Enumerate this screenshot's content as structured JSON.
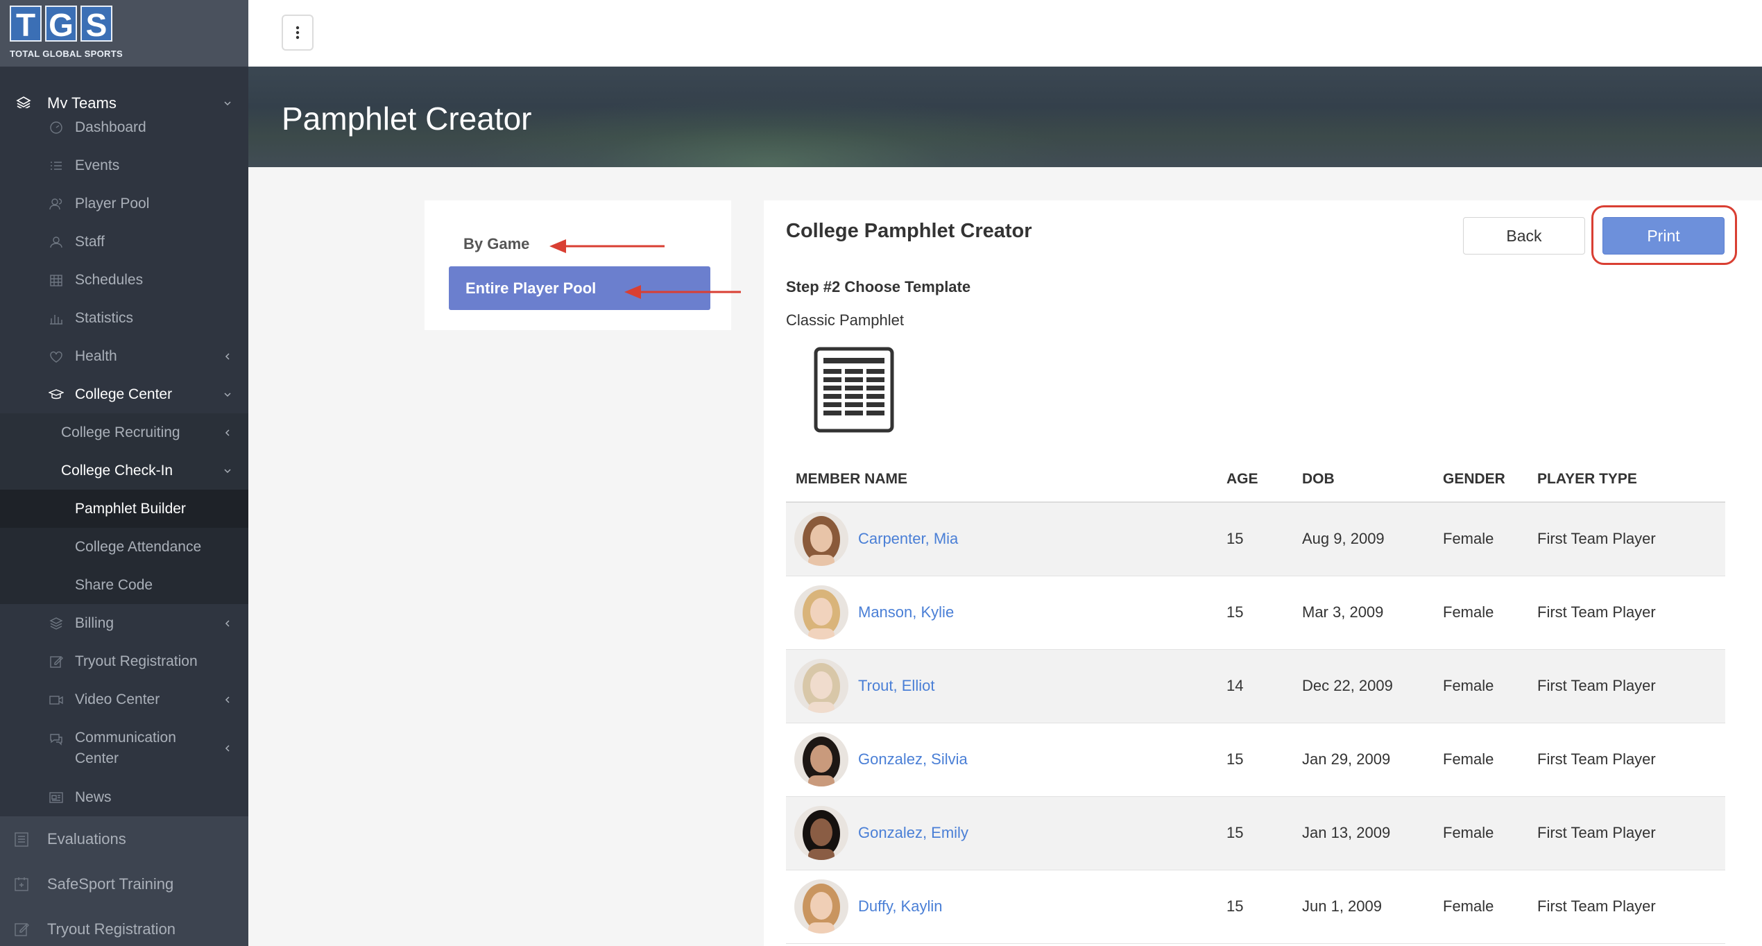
{
  "logo": {
    "letters": [
      "T",
      "G",
      "S"
    ],
    "subtitle": "TOTAL GLOBAL SPORTS"
  },
  "sidebar": {
    "my_teams": "My Teams",
    "items": [
      {
        "label": "Dashboard",
        "icon": "dashboard-icon"
      },
      {
        "label": "Events",
        "icon": "list-icon"
      },
      {
        "label": "Player Pool",
        "icon": "users-icon"
      },
      {
        "label": "Staff",
        "icon": "user-icon"
      },
      {
        "label": "Schedules",
        "icon": "calendar-icon"
      },
      {
        "label": "Statistics",
        "icon": "bar-chart-icon"
      },
      {
        "label": "Health",
        "icon": "heart-icon"
      }
    ],
    "college_center": "College Center",
    "college_recruiting": "College Recruiting",
    "college_checkin": "College Check-In",
    "checkin_items": [
      "Pamphlet Builder",
      "College Attendance",
      "Share Code"
    ],
    "more_items": [
      {
        "label": "Billing",
        "icon": "layers-icon"
      },
      {
        "label": "Tryout Registration",
        "icon": "edit-icon"
      },
      {
        "label": "Video Center",
        "icon": "video-icon"
      },
      {
        "label": "Communication Center",
        "icon": "chat-icon"
      },
      {
        "label": "News",
        "icon": "newspaper-icon"
      }
    ],
    "bottom_items": [
      {
        "label": "Evaluations",
        "icon": "clipboard-icon"
      },
      {
        "label": "SafeSport Training",
        "icon": "certificate-icon"
      },
      {
        "label": "Tryout Registration",
        "icon": "edit-icon"
      }
    ]
  },
  "banner": {
    "title": "Pamphlet Creator"
  },
  "left_card": {
    "by_game": "By Game",
    "entire_pool": "Entire Player Pool"
  },
  "main": {
    "title": "College Pamphlet Creator",
    "back": "Back",
    "print": "Print",
    "step": "Step #2 Choose Template",
    "template_name": "Classic Pamphlet",
    "columns": [
      "MEMBER NAME",
      "AGE",
      "DOB",
      "GENDER",
      "PLAYER TYPE"
    ],
    "rows": [
      {
        "name": "Carpenter, Mia",
        "age": "15",
        "dob": "Aug 9, 2009",
        "gender": "Female",
        "type": "First Team Player",
        "hair": "#8a5a3a",
        "skin": "#e8c4a8"
      },
      {
        "name": "Manson, Kylie",
        "age": "15",
        "dob": "Mar 3, 2009",
        "gender": "Female",
        "type": "First Team Player",
        "hair": "#d9b47a",
        "skin": "#f1d3bd"
      },
      {
        "name": "Trout, Elliot",
        "age": "14",
        "dob": "Dec 22, 2009",
        "gender": "Female",
        "type": "First Team Player",
        "hair": "#d8c7a8",
        "skin": "#f0dccd"
      },
      {
        "name": "Gonzalez, Silvia",
        "age": "15",
        "dob": "Jan 29, 2009",
        "gender": "Female",
        "type": "First Team Player",
        "hair": "#1d1714",
        "skin": "#c99a7c"
      },
      {
        "name": "Gonzalez, Emily",
        "age": "15",
        "dob": "Jan 13, 2009",
        "gender": "Female",
        "type": "First Team Player",
        "hair": "#15110f",
        "skin": "#8a5d44"
      },
      {
        "name": "Duffy, Kaylin",
        "age": "15",
        "dob": "Jun 1, 2009",
        "gender": "Female",
        "type": "First Team Player",
        "hair": "#c9955f",
        "skin": "#f0cfb6"
      }
    ]
  },
  "colors": {
    "accent": "#6b7fce",
    "print": "#6d90db",
    "link": "#4a7fd6",
    "annotation": "#d93f33"
  }
}
